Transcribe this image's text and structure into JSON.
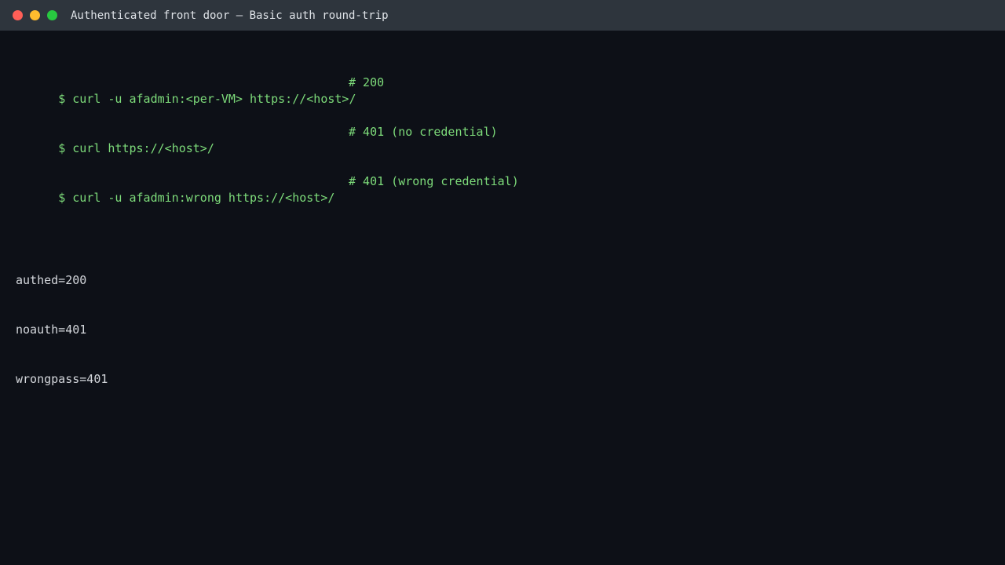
{
  "window": {
    "title": "Authenticated front door — Basic auth round-trip",
    "controls": {
      "close_color": "#ff5f57",
      "minimize_color": "#febc2e",
      "maximize_color": "#28c840"
    }
  },
  "terminal": {
    "commands": [
      {
        "text": "$ curl -u afadmin:<per-VM> https://<host>/",
        "comment": "# 200"
      },
      {
        "text": "$ curl https://<host>/",
        "comment": "# 401 (no credential)"
      },
      {
        "text": "$ curl -u afadmin:wrong https://<host>/",
        "comment": "# 401 (wrong credential)"
      }
    ],
    "output": [
      "authed=200",
      "noauth=401",
      "wrongpass=401"
    ],
    "colors": {
      "background": "#0d1017",
      "command": "#7ddb7a",
      "output": "#d4d7dc"
    }
  }
}
